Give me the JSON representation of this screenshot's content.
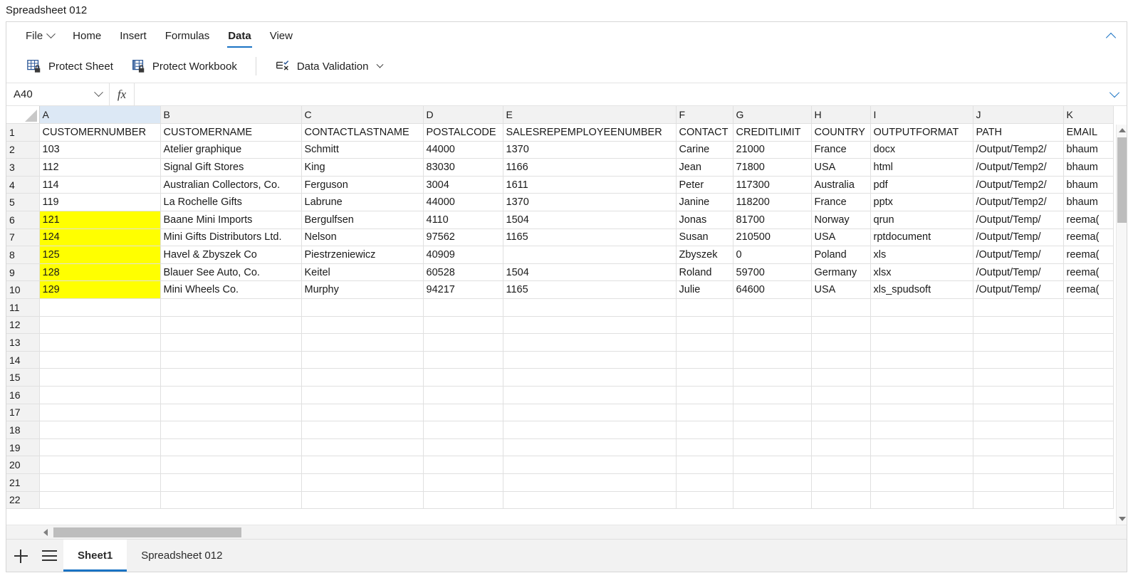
{
  "window": {
    "title": "Spreadsheet 012"
  },
  "ribbon": {
    "tabs": [
      {
        "label": "File",
        "active": false,
        "has_caret": true
      },
      {
        "label": "Home",
        "active": false
      },
      {
        "label": "Insert",
        "active": false
      },
      {
        "label": "Formulas",
        "active": false
      },
      {
        "label": "Data",
        "active": true
      },
      {
        "label": "View",
        "active": false
      }
    ],
    "collapse_icon": "chevron-up-icon",
    "commands": [
      {
        "label": "Protect Sheet",
        "icon": "protect-sheet-icon"
      },
      {
        "label": "Protect Workbook",
        "icon": "protect-workbook-icon"
      },
      {
        "label": "Data Validation",
        "icon": "data-validation-icon",
        "has_caret": true
      }
    ]
  },
  "formula_bar": {
    "name_box_value": "A40",
    "fx_label": "fx",
    "formula_value": "",
    "expand_icon": "chevron-down-icon"
  },
  "grid": {
    "columns": [
      "A",
      "B",
      "C",
      "D",
      "E",
      "F",
      "G",
      "H",
      "I",
      "J",
      "K"
    ],
    "selected_column": "A",
    "rows": [
      "1",
      "2",
      "3",
      "4",
      "5",
      "6",
      "7",
      "8",
      "9",
      "10",
      "11",
      "12",
      "13",
      "14",
      "15",
      "16",
      "17",
      "18",
      "19",
      "20",
      "21",
      "22"
    ],
    "header_row": {
      "row": "1",
      "cells": [
        "CUSTOMERNUMBER",
        "CUSTOMERNAME",
        "CONTACTLASTNAME",
        "POSTALCODE",
        "SALESREPEMPLOYEENUMBER",
        "CONTACT",
        "CREDITLIMIT",
        "COUNTRY",
        "OUTPUTFORMAT",
        "PATH",
        "EMAIL"
      ]
    },
    "data_rows": [
      {
        "row": "2",
        "highlight": false,
        "cells": [
          "103",
          "Atelier graphique",
          "Schmitt",
          "44000",
          "1370",
          "Carine",
          "21000",
          "France",
          "docx",
          "/Output/Temp2/",
          "bhaum"
        ]
      },
      {
        "row": "3",
        "highlight": false,
        "cells": [
          "112",
          "Signal Gift Stores",
          "King",
          "83030",
          "1166",
          "Jean",
          "71800",
          "USA",
          "html",
          "/Output/Temp2/",
          "bhaum"
        ]
      },
      {
        "row": "4",
        "highlight": false,
        "cells": [
          "114",
          "Australian Collectors, Co.",
          "Ferguson",
          "3004",
          "1611",
          "Peter",
          "117300",
          "Australia",
          "pdf",
          "/Output/Temp2/",
          "bhaum"
        ]
      },
      {
        "row": "5",
        "highlight": false,
        "cells": [
          "119",
          "La Rochelle Gifts",
          "Labrune",
          "44000",
          "1370",
          "Janine",
          "118200",
          "France",
          "pptx",
          "/Output/Temp2/",
          "bhaum"
        ]
      },
      {
        "row": "6",
        "highlight": true,
        "cells": [
          "121",
          "Baane Mini Imports",
          "Bergulfsen",
          "4110",
          "1504",
          "Jonas",
          "81700",
          "Norway",
          "qrun",
          "/Output/Temp/",
          "reema("
        ]
      },
      {
        "row": "7",
        "highlight": true,
        "cells": [
          "124",
          "Mini Gifts Distributors Ltd.",
          "Nelson",
          "97562",
          "1165",
          "Susan",
          "210500",
          "USA",
          "rptdocument",
          "/Output/Temp/",
          "reema("
        ]
      },
      {
        "row": "8",
        "highlight": true,
        "cells": [
          "125",
          "Havel & Zbyszek Co",
          "Piestrzeniewicz",
          "40909",
          "",
          "Zbyszek",
          "0",
          "Poland",
          "xls",
          "/Output/Temp/",
          "reema("
        ]
      },
      {
        "row": "9",
        "highlight": true,
        "cells": [
          "128",
          "Blauer See Auto, Co.",
          "Keitel",
          "60528",
          "1504",
          "Roland",
          "59700",
          "Germany",
          "xlsx",
          "/Output/Temp/",
          "reema("
        ]
      },
      {
        "row": "10",
        "highlight": true,
        "cells": [
          "129",
          "Mini Wheels Co.",
          "Murphy",
          "94217",
          "1165",
          "Julie",
          "64600",
          "USA",
          "xls_spudsoft",
          "/Output/Temp/",
          "reema("
        ]
      }
    ],
    "empty_rows": [
      "11",
      "12",
      "13",
      "14",
      "15",
      "16",
      "17",
      "18",
      "19",
      "20",
      "21",
      "22"
    ],
    "numeric_columns": [
      0,
      3,
      4,
      6
    ],
    "highlight_color": "#ffff00",
    "highlight_text_color": "#ff0000"
  },
  "sheet_tabs": {
    "add_sheet_icon": "plus-icon",
    "all_sheets_icon": "hamburger-icon",
    "tabs": [
      {
        "label": "Sheet1",
        "active": true
      },
      {
        "label": "Spreadsheet 012",
        "active": false
      }
    ]
  },
  "theme": {
    "accent": "#1a73c4",
    "header_bg": "#f2f2f2",
    "selected_header_bg": "#dce8f5"
  }
}
